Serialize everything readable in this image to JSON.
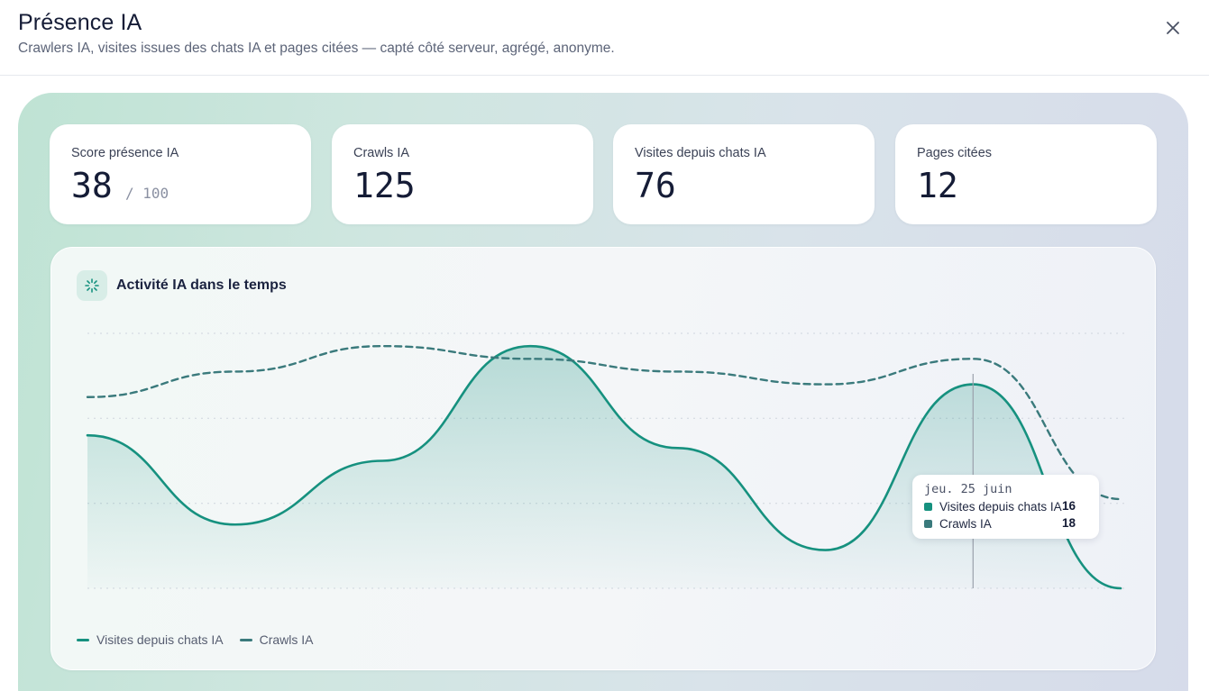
{
  "header": {
    "title": "Présence IA",
    "subtitle": "Crawlers IA, visites issues des chats IA et pages citées — capté côté serveur, agrégé, anonyme.",
    "close_icon": "close-icon"
  },
  "kpis": [
    {
      "label": "Score présence IA",
      "value": "38",
      "suffix": "/ 100"
    },
    {
      "label": "Crawls IA",
      "value": "125"
    },
    {
      "label": "Visites depuis chats IA",
      "value": "76"
    },
    {
      "label": "Pages citées",
      "value": "12"
    }
  ],
  "chart": {
    "title": "Activité IA dans le temps",
    "icon": "sparkle-icon",
    "colors": {
      "visits": "#16917f",
      "crawls": "#3a7a7c"
    },
    "tooltip": {
      "date": "jeu. 25 juin",
      "rows": [
        {
          "label": "Visites depuis chats IA",
          "value": "16"
        },
        {
          "label": "Crawls IA",
          "value": "18"
        }
      ]
    },
    "legend": [
      {
        "label": "Visites depuis chats IA"
      },
      {
        "label": "Crawls IA"
      }
    ]
  },
  "chart_data": {
    "type": "area",
    "point_count": 8,
    "series": [
      {
        "name": "Visites depuis chats IA",
        "style": "solid-area",
        "color": "#16917f",
        "values": [
          12,
          5,
          10,
          19,
          11,
          3,
          16,
          0
        ]
      },
      {
        "name": "Crawls IA",
        "style": "dashed",
        "color": "#3a7a7c",
        "values": [
          15,
          17,
          19,
          18,
          17,
          16,
          18,
          7
        ]
      }
    ],
    "highlight_index": 6,
    "ylim": [
      0,
      20
    ],
    "grid": "horizontal-dotted",
    "legend_position": "bottom-left"
  }
}
